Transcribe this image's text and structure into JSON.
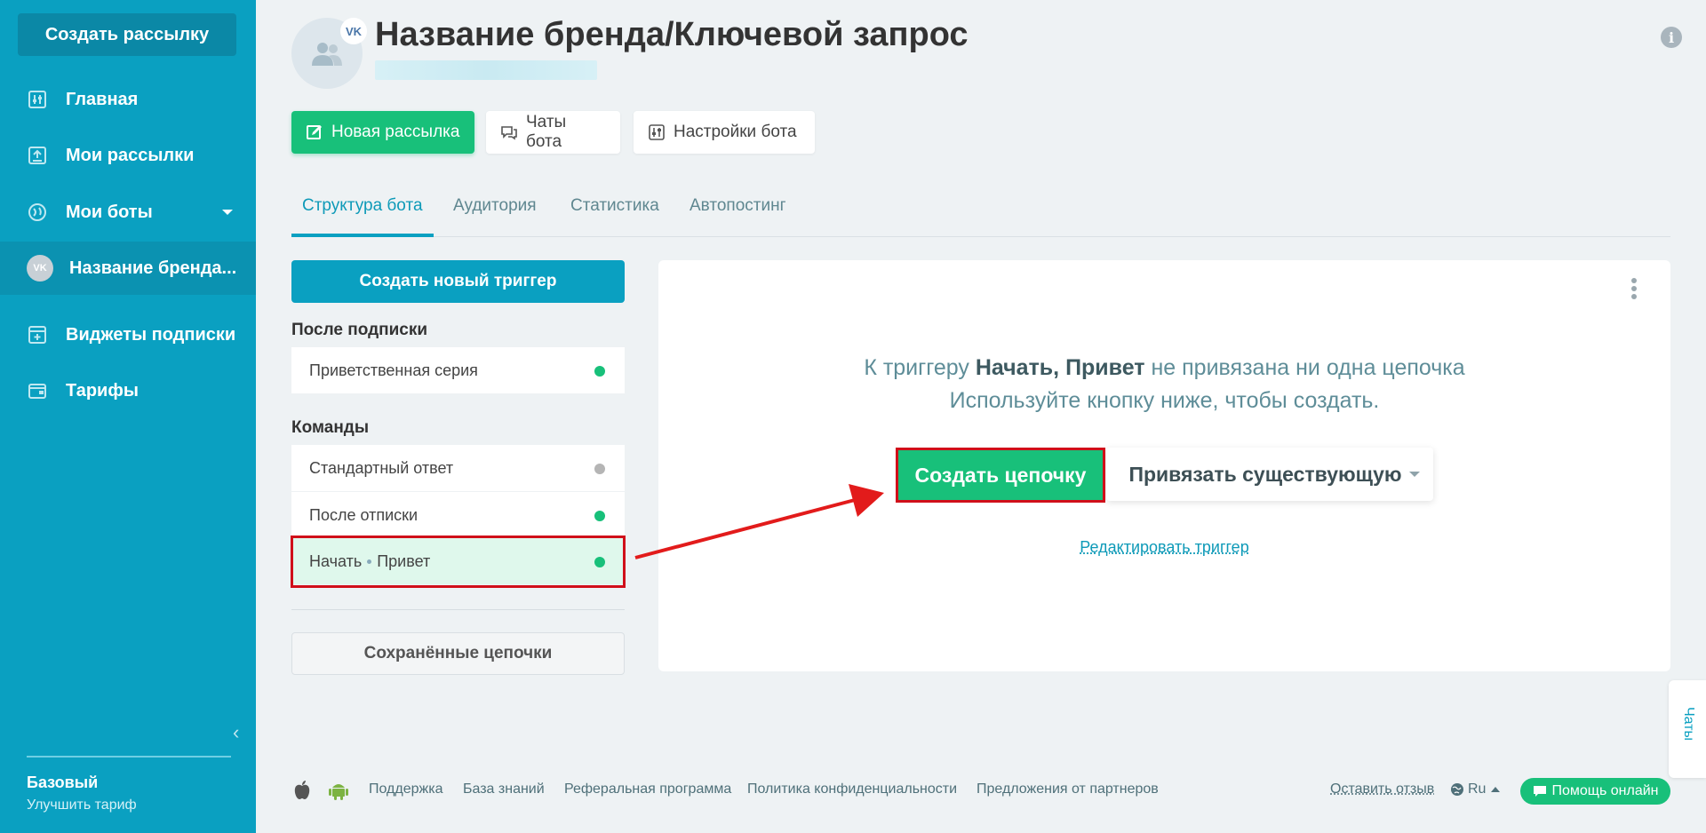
{
  "sidebar": {
    "create_button": "Создать рассылку",
    "items": [
      {
        "label": "Главная",
        "icon": "dashboard-icon"
      },
      {
        "label": "Мои рассылки",
        "icon": "mailing-icon"
      },
      {
        "label": "Мои боты",
        "icon": "bots-icon"
      },
      {
        "label": "Название бренда...",
        "icon": "vk-icon"
      },
      {
        "label": "Виджеты подписки",
        "icon": "widget-icon"
      },
      {
        "label": "Тарифы",
        "icon": "wallet-icon"
      }
    ],
    "plan_name": "Базовый",
    "plan_upgrade": "Улучшить тариф"
  },
  "header": {
    "title": "Название бренда/Ключевой запрос",
    "vk_badge": "VK",
    "buttons": {
      "new_mailing": "Новая рассылка",
      "bot_chats": "Чаты бота",
      "bot_settings": "Настройки бота"
    }
  },
  "tabs": [
    {
      "label": "Структура бота",
      "active": true
    },
    {
      "label": "Аудитория",
      "active": false
    },
    {
      "label": "Статистика",
      "active": false
    },
    {
      "label": "Автопостинг",
      "active": false
    }
  ],
  "triggers": {
    "create_button": "Создать новый триггер",
    "after_subscription_label": "После подписки",
    "after_subscription": [
      {
        "label": "Приветственная серия",
        "status": "active"
      }
    ],
    "commands_label": "Команды",
    "commands": [
      {
        "label": "Стандартный ответ",
        "status": "inactive"
      },
      {
        "label": "После отписки",
        "status": "active"
      },
      {
        "label_a": "Начать",
        "label_b": "Привет",
        "status": "active",
        "selected": true
      }
    ],
    "saved_chains": "Сохранённые цепочки"
  },
  "main": {
    "message_prefix": "К триггеру ",
    "message_trigger": "Начать, Привет",
    "message_suffix": " не привязана ни одна цепочка",
    "message_line2": "Используйте кнопку ниже, чтобы создать.",
    "create_chain": "Создать цепочку",
    "bind_existing": "Привязать существующую",
    "edit_trigger": "Редактировать триггер"
  },
  "chats_tab": "Чаты",
  "footer": {
    "links": [
      "Поддержка",
      "База знаний",
      "Реферальная программа",
      "Политика конфиденциальности",
      "Предложения от партнеров"
    ],
    "review": "Оставить отзыв",
    "language": "Ru",
    "help": "Помощь онлайн"
  },
  "colors": {
    "sidebar": "#0aa0c1",
    "accent_green": "#18c07a",
    "highlight_red": "#d0101a",
    "status_active": "#18c07a",
    "status_inactive": "#b5b5b5"
  }
}
